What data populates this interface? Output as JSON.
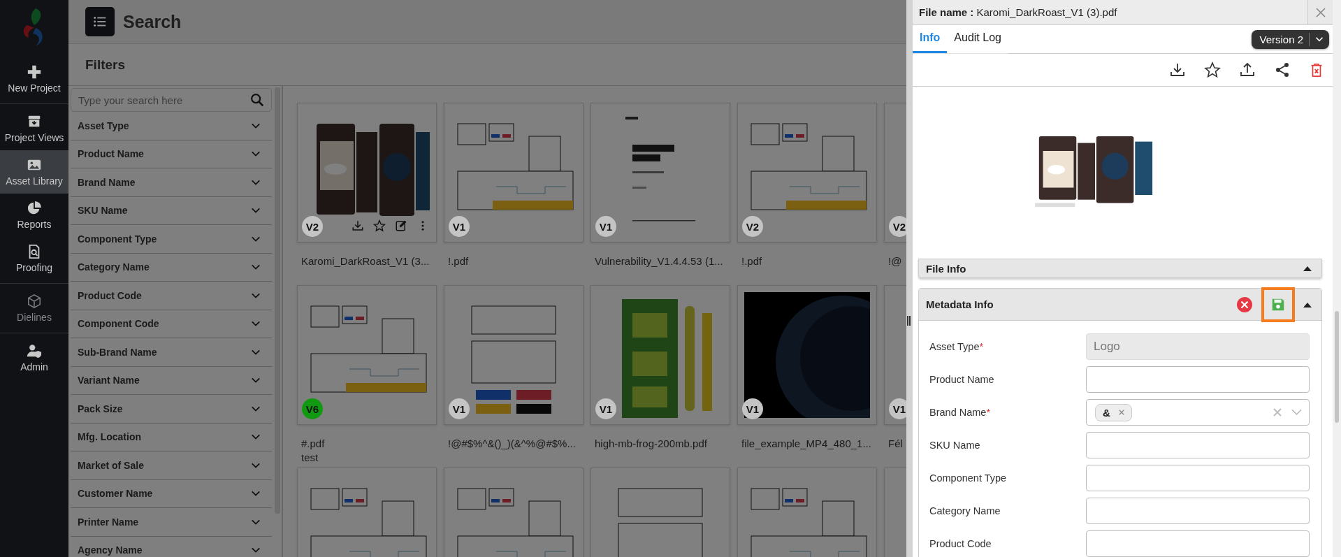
{
  "sidebar": {
    "groups": [
      [
        {
          "label": "New Project",
          "selected": false,
          "disabled": false
        }
      ],
      [
        {
          "label": "Project Views",
          "selected": false,
          "disabled": false
        },
        {
          "label": "Asset Library",
          "selected": true,
          "disabled": false
        },
        {
          "label": "Reports",
          "selected": false,
          "disabled": false
        },
        {
          "label": "Proofing",
          "selected": false,
          "disabled": false
        }
      ],
      [
        {
          "label": "Dielines",
          "selected": false,
          "disabled": true
        }
      ],
      [
        {
          "label": "Admin",
          "selected": false,
          "disabled": false
        }
      ]
    ]
  },
  "header": {
    "title": "Search"
  },
  "filters": {
    "title": "Filters",
    "search": {
      "placeholder": "Type your search here"
    },
    "items": [
      "Asset Type",
      "Product Name",
      "Brand Name",
      "SKU Name",
      "Component Type",
      "Category Name",
      "Product Code",
      "Component Code",
      "Sub-Brand Name",
      "Variant Name",
      "Pack Size",
      "Mfg. Location",
      "Market of Sale",
      "Customer Name",
      "Printer Name",
      "Agency Name"
    ]
  },
  "assets": {
    "cards": [
      {
        "kind": "picture",
        "version": "V2",
        "color": "#c4c4c4",
        "name": "Karomi_DarkRoast_V1 (3...",
        "show_actions": true
      },
      {
        "kind": "picture",
        "version": "V1",
        "color": "#c4c4c4",
        "name": "!.pdf",
        "show_actions": false
      },
      {
        "kind": "picture",
        "version": "V1",
        "color": "#c4c4c4",
        "name": "Vulnerability_V1.4.4.53 (1...",
        "show_actions": false
      },
      {
        "kind": "picture",
        "version": "V2",
        "color": "#c4c4c4",
        "name": "!.pdf",
        "show_actions": false
      },
      {
        "kind": "picture",
        "version": "V2",
        "color": "#c4c4c4",
        "name": "!@"
      },
      {
        "kind": "picture",
        "version": "V6",
        "color": "#119a11",
        "name": "#.pdf",
        "subtitle": "test",
        "show_actions": false
      },
      {
        "kind": "picture",
        "version": "V1",
        "color": "#c4c4c4",
        "name": "!@#$%^&()_)(&^%@#$%...",
        "show_actions": false
      },
      {
        "kind": "picture",
        "version": "V1",
        "color": "#c4c4c4",
        "name": "high-mb-frog-200mb.pdf",
        "show_actions": false
      },
      {
        "kind": "picture",
        "version": "V1",
        "color": "#c4c4c4",
        "name": "file_example_MP4_480_1...",
        "show_actions": false
      },
      {
        "kind": "picture",
        "version": "V1",
        "color": "#c4c4c4",
        "name": "Fél"
      },
      {
        "kind": "picture"
      },
      {
        "kind": "picture"
      },
      {
        "kind": "picture"
      },
      {
        "kind": "picture"
      },
      {
        "kind": "picture"
      }
    ]
  },
  "panel": {
    "file_name_label": "File name :",
    "file_name": "Karomi_DarkRoast_V1 (3).pdf",
    "tabs": [
      {
        "label": "Info",
        "selected": true
      },
      {
        "label": "Audit Log",
        "selected": false
      }
    ],
    "version": "Version 2",
    "file_info": {
      "title": "File Info"
    },
    "metadata": {
      "title": "Metadata Info",
      "save_highlighted": true,
      "fields": [
        {
          "label": "Asset Type",
          "required_mark": "*",
          "kind": "text",
          "value": "Logo",
          "disabled": true
        },
        {
          "label": "Product Name",
          "kind": "text",
          "disabled": false
        },
        {
          "label": "Brand Name",
          "required_mark": "*",
          "kind": "multiselect",
          "tags": [
            "&"
          ],
          "disabled": false
        },
        {
          "label": "SKU Name",
          "kind": "text",
          "disabled": false
        },
        {
          "label": "Component Type",
          "kind": "text",
          "disabled": false
        },
        {
          "label": "Category Name",
          "kind": "text",
          "disabled": false
        },
        {
          "label": "Product Code",
          "kind": "text",
          "disabled": false
        }
      ]
    }
  }
}
